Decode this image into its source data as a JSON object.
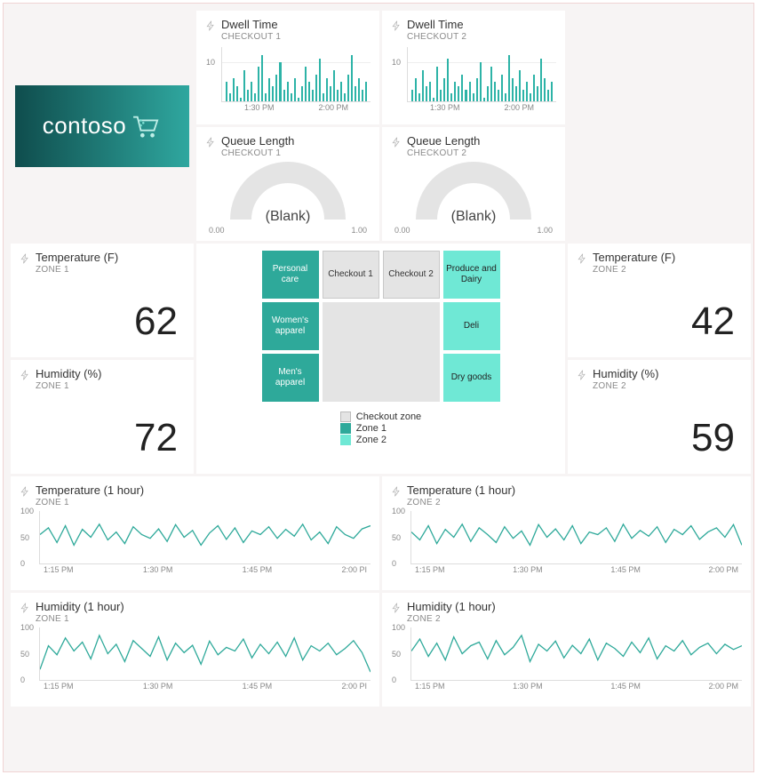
{
  "brand": {
    "name": "contoso"
  },
  "colors": {
    "zone1": "#2ea99a",
    "zone2": "#6fe8d5",
    "checkout": "#e4e4e4",
    "accent": "#2db3a7"
  },
  "dwell1": {
    "title": "Dwell Time",
    "sub": "CHECKOUT 1"
  },
  "dwell2": {
    "title": "Dwell Time",
    "sub": "CHECKOUT 2"
  },
  "queue1": {
    "title": "Queue Length",
    "sub": "CHECKOUT 1",
    "value": "(Blank)",
    "min": "0.00",
    "max": "1.00"
  },
  "queue2": {
    "title": "Queue Length",
    "sub": "CHECKOUT 2",
    "value": "(Blank)",
    "min": "0.00",
    "max": "1.00"
  },
  "temp1": {
    "title": "Temperature (F)",
    "sub": "ZONE 1",
    "value": "62"
  },
  "temp2": {
    "title": "Temperature (F)",
    "sub": "ZONE 2",
    "value": "42"
  },
  "hum1": {
    "title": "Humidity (%)",
    "sub": "ZONE 1",
    "value": "72"
  },
  "hum2": {
    "title": "Humidity (%)",
    "sub": "ZONE 2",
    "value": "59"
  },
  "map": {
    "zones": {
      "personal_care": "Personal care",
      "checkout1": "Checkout 1",
      "checkout2": "Checkout 2",
      "produce": "Produce and Dairy",
      "womens": "Women's apparel",
      "deli": "Deli",
      "mens": "Men's apparel",
      "dry": "Dry goods"
    },
    "legend": {
      "checkout": "Checkout zone",
      "z1": "Zone 1",
      "z2": "Zone 2"
    }
  },
  "tempHist1": {
    "title": "Temperature (1 hour)",
    "sub": "ZONE 1"
  },
  "tempHist2": {
    "title": "Temperature (1 hour)",
    "sub": "ZONE 2"
  },
  "humHist1": {
    "title": "Humidity (1 hour)",
    "sub": "ZONE 1"
  },
  "humHist2": {
    "title": "Humidity (1 hour)",
    "sub": "ZONE 2"
  },
  "axis": {
    "dwell_y": [
      "10"
    ],
    "dwell_x": [
      "1:30 PM",
      "2:00 PM"
    ],
    "line_y": [
      "0",
      "50",
      "100"
    ],
    "line_x": [
      "1:15 PM",
      "1:30 PM",
      "1:45 PM",
      "2:00 PM"
    ],
    "line_x_trunc": [
      "1:15 PM",
      "1:30 PM",
      "1:45 PM",
      "2:00 PI"
    ]
  },
  "chart_data": [
    {
      "id": "dwell1",
      "type": "bar",
      "title": "Dwell Time",
      "subtitle": "CHECKOUT 1",
      "x_ticks": [
        "1:30 PM",
        "2:00 PM"
      ],
      "ylim": [
        0,
        14
      ],
      "y_ticks": [
        10
      ],
      "values": [
        5,
        2,
        6,
        4,
        1,
        8,
        3,
        5,
        2,
        9,
        12,
        2,
        6,
        4,
        7,
        10,
        3,
        5,
        2,
        6,
        1,
        4,
        9,
        5,
        3,
        7,
        11,
        2,
        6,
        4,
        8,
        3,
        5,
        2,
        7,
        12,
        4,
        6,
        3,
        5
      ]
    },
    {
      "id": "dwell2",
      "type": "bar",
      "title": "Dwell Time",
      "subtitle": "CHECKOUT 2",
      "x_ticks": [
        "1:30 PM",
        "2:00 PM"
      ],
      "ylim": [
        0,
        14
      ],
      "y_ticks": [
        10
      ],
      "values": [
        3,
        6,
        2,
        8,
        4,
        5,
        1,
        9,
        3,
        6,
        11,
        2,
        5,
        4,
        7,
        3,
        5,
        2,
        6,
        10,
        1,
        4,
        9,
        5,
        3,
        7,
        2,
        12,
        6,
        4,
        8,
        3,
        5,
        2,
        7,
        4,
        11,
        6,
        3,
        5
      ]
    },
    {
      "id": "queue1",
      "type": "gauge",
      "title": "Queue Length",
      "subtitle": "CHECKOUT 1",
      "min": 0.0,
      "max": 1.0,
      "value": null,
      "display": "(Blank)"
    },
    {
      "id": "queue2",
      "type": "gauge",
      "title": "Queue Length",
      "subtitle": "CHECKOUT 2",
      "min": 0.0,
      "max": 1.0,
      "value": null,
      "display": "(Blank)"
    },
    {
      "id": "tempHist1",
      "type": "line",
      "title": "Temperature (1 hour)",
      "subtitle": "ZONE 1",
      "x_ticks": [
        "1:15 PM",
        "1:30 PM",
        "1:45 PM",
        "2:00 PM"
      ],
      "ylim": [
        0,
        100
      ],
      "y_ticks": [
        0,
        50,
        100
      ],
      "values": [
        55,
        68,
        40,
        72,
        35,
        65,
        50,
        75,
        45,
        60,
        38,
        70,
        55,
        48,
        66,
        42,
        74,
        50,
        63,
        35,
        58,
        72,
        46,
        68,
        40,
        62,
        55,
        70,
        48,
        65,
        52,
        75,
        45,
        60,
        38,
        70,
        55,
        48,
        66,
        72
      ]
    },
    {
      "id": "tempHist2",
      "type": "line",
      "title": "Temperature (1 hour)",
      "subtitle": "ZONE 2",
      "x_ticks": [
        "1:15 PM",
        "1:30 PM",
        "1:45 PM",
        "2:00 PM"
      ],
      "ylim": [
        0,
        100
      ],
      "y_ticks": [
        0,
        50,
        100
      ],
      "values": [
        60,
        45,
        72,
        38,
        65,
        50,
        75,
        42,
        68,
        55,
        40,
        70,
        48,
        62,
        35,
        74,
        50,
        66,
        45,
        72,
        38,
        60,
        55,
        68,
        42,
        75,
        48,
        63,
        52,
        70,
        40,
        65,
        55,
        72,
        46,
        60,
        68,
        50,
        74,
        35
      ]
    },
    {
      "id": "humHist1",
      "type": "line",
      "title": "Humidity (1 hour)",
      "subtitle": "ZONE 1",
      "x_ticks": [
        "1:15 PM",
        "1:30 PM",
        "1:45 PM",
        "2:00 PM"
      ],
      "ylim": [
        0,
        100
      ],
      "y_ticks": [
        0,
        50,
        100
      ],
      "values": [
        20,
        65,
        48,
        80,
        55,
        72,
        40,
        85,
        50,
        68,
        35,
        75,
        60,
        45,
        82,
        38,
        70,
        52,
        66,
        30,
        74,
        48,
        62,
        55,
        78,
        42,
        68,
        50,
        72,
        45,
        80,
        38,
        65,
        55,
        70,
        48,
        60,
        75,
        52,
        15
      ]
    },
    {
      "id": "humHist2",
      "type": "line",
      "title": "Humidity (1 hour)",
      "subtitle": "ZONE 2",
      "x_ticks": [
        "1:15 PM",
        "1:30 PM",
        "1:45 PM",
        "2:00 PM"
      ],
      "ylim": [
        0,
        100
      ],
      "y_ticks": [
        0,
        50,
        100
      ],
      "values": [
        55,
        78,
        45,
        70,
        38,
        82,
        50,
        65,
        72,
        40,
        75,
        48,
        62,
        85,
        35,
        68,
        55,
        74,
        42,
        66,
        50,
        78,
        38,
        70,
        60,
        45,
        72,
        52,
        80,
        40,
        65,
        55,
        75,
        48,
        62,
        70,
        50,
        68,
        58,
        65
      ]
    }
  ]
}
